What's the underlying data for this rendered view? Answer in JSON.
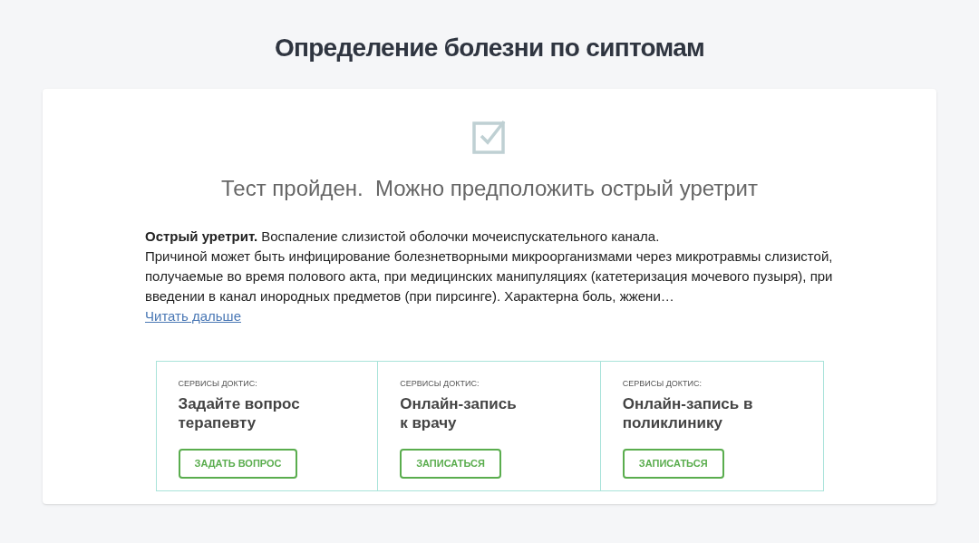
{
  "page_title": "Определение болезни по сиптомам",
  "result": {
    "title": "Тест пройден.  Можно предположить острый уретрит",
    "checked": true
  },
  "description": {
    "lines": [
      "**Острый уретрит.** Воспаление слизистой оболочки мочеиспускательного канала.",
      "Причиной может быть инфицирование болезнетворными микроорганизмами через микротравмы слизистой, получаемые во время полового акта, при медицинских манипуляциях (катетеризация мочевого пузыря), при введении в канал инородных предметов (при пирсинге). Характерна боль, жжени…"
    ],
    "link": "Читать дальше"
  },
  "services": [
    {
      "label": "СЕРВИСЫ ДОКТИС:",
      "title_lines": [
        "Задайте вопрос",
        "терапевту"
      ],
      "button": "ЗАДАТЬ ВОПРОС"
    },
    {
      "label": "СЕРВИСЫ ДОКТИС:",
      "title_lines": [
        "Онлайн-запись",
        "к врачу"
      ],
      "button": "ЗАПИСАТЬСЯ"
    },
    {
      "label": "СЕРВИСЫ ДОКТИС:",
      "title_lines": [
        "Онлайн-запись в",
        "поликлинику"
      ],
      "button": "ЗАПИСАТЬСЯ"
    }
  ]
}
